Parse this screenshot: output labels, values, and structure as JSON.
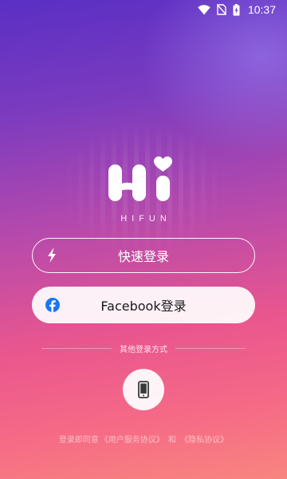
{
  "status_bar": {
    "time": "10:37",
    "icons": [
      "wifi-icon",
      "no-sim-icon",
      "battery-charging-icon"
    ]
  },
  "brand": {
    "logo_text": "Hi",
    "name": "HIFUN"
  },
  "buttons": {
    "quick_login": {
      "label": "快速登录",
      "icon": "lightning-icon"
    },
    "facebook_login": {
      "label": "Facebook登录",
      "icon": "facebook-icon"
    }
  },
  "other_methods": {
    "label": "其他登录方式",
    "phone_icon": "phone-icon"
  },
  "agreement": {
    "prefix": "登录即同意",
    "user_agreement": "《用户服务协议》",
    "conjunction": "和",
    "privacy_agreement": "《隐私协议》"
  },
  "colors": {
    "gradient_top": "#5a2fc4",
    "gradient_mid": "#b449ad",
    "gradient_bottom": "#f8857f",
    "facebook_blue": "#1877f2",
    "phone_icon": "#3a3a3a"
  }
}
